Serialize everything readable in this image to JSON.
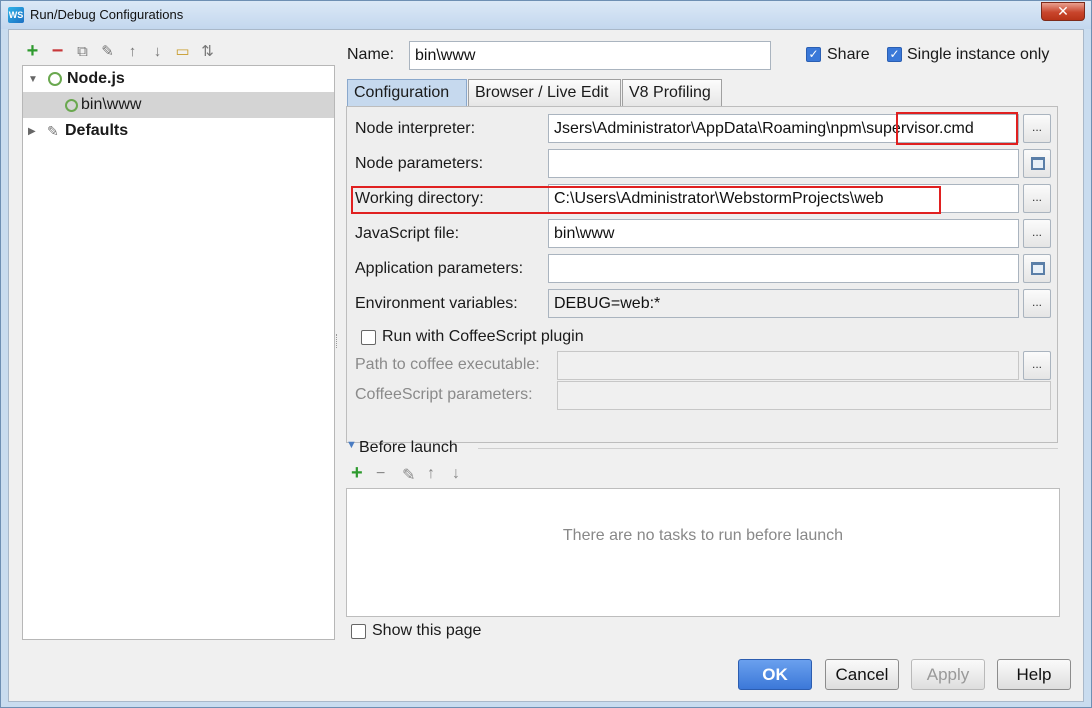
{
  "window": {
    "title": "Run/Debug Configurations",
    "app_icon_text": "WS",
    "close_glyph": "✕"
  },
  "toolbar": {
    "icons": [
      "add-icon",
      "remove-icon",
      "copy-icon",
      "wrench-icon",
      "move-up-icon",
      "move-down-icon",
      "folder-icon",
      "sort-icon"
    ]
  },
  "tree": {
    "items": [
      {
        "label": "Node.js",
        "expanded": true
      },
      {
        "label": "bin\\www",
        "selected": true
      },
      {
        "label": "Defaults",
        "expanded": false
      }
    ]
  },
  "header": {
    "name_label": "Name:",
    "name_value": "bin\\www",
    "share_label": "Share",
    "share_checked": true,
    "single_instance_label": "Single instance only",
    "single_instance_checked": true
  },
  "tabs": [
    {
      "label": "Configuration",
      "active": true
    },
    {
      "label": "Browser / Live Edit",
      "active": false
    },
    {
      "label": "V8 Profiling",
      "active": false
    }
  ],
  "config": {
    "node_interpreter_label": "Node interpreter:",
    "node_interpreter_value": "Jsers\\Administrator\\AppData\\Roaming\\npm\\supervisor.cmd",
    "node_parameters_label": "Node parameters:",
    "node_parameters_value": "",
    "working_directory_label": "Working directory:",
    "working_directory_value": "C:\\Users\\Administrator\\WebstormProjects\\web",
    "js_file_label": "JavaScript file:",
    "js_file_value": "bin\\www",
    "app_params_label": "Application parameters:",
    "app_params_value": "",
    "env_vars_label": "Environment variables:",
    "env_vars_value": "DEBUG=web:*",
    "coffee_label": "Run with CoffeeScript plugin",
    "coffee_checked": false,
    "coffee_path_label": "Path to coffee executable:",
    "coffee_params_label": "CoffeeScript parameters:",
    "dots_glyph": "..."
  },
  "before_launch": {
    "title": "Before launch",
    "empty_text": "There are no tasks to run before launch",
    "show_page_label": "Show this page",
    "show_page_checked": false
  },
  "buttons": {
    "ok": "OK",
    "cancel": "Cancel",
    "apply": "Apply",
    "help": "Help"
  },
  "colors": {
    "highlight_box": "#e02020",
    "accent": "#3c78d8"
  }
}
